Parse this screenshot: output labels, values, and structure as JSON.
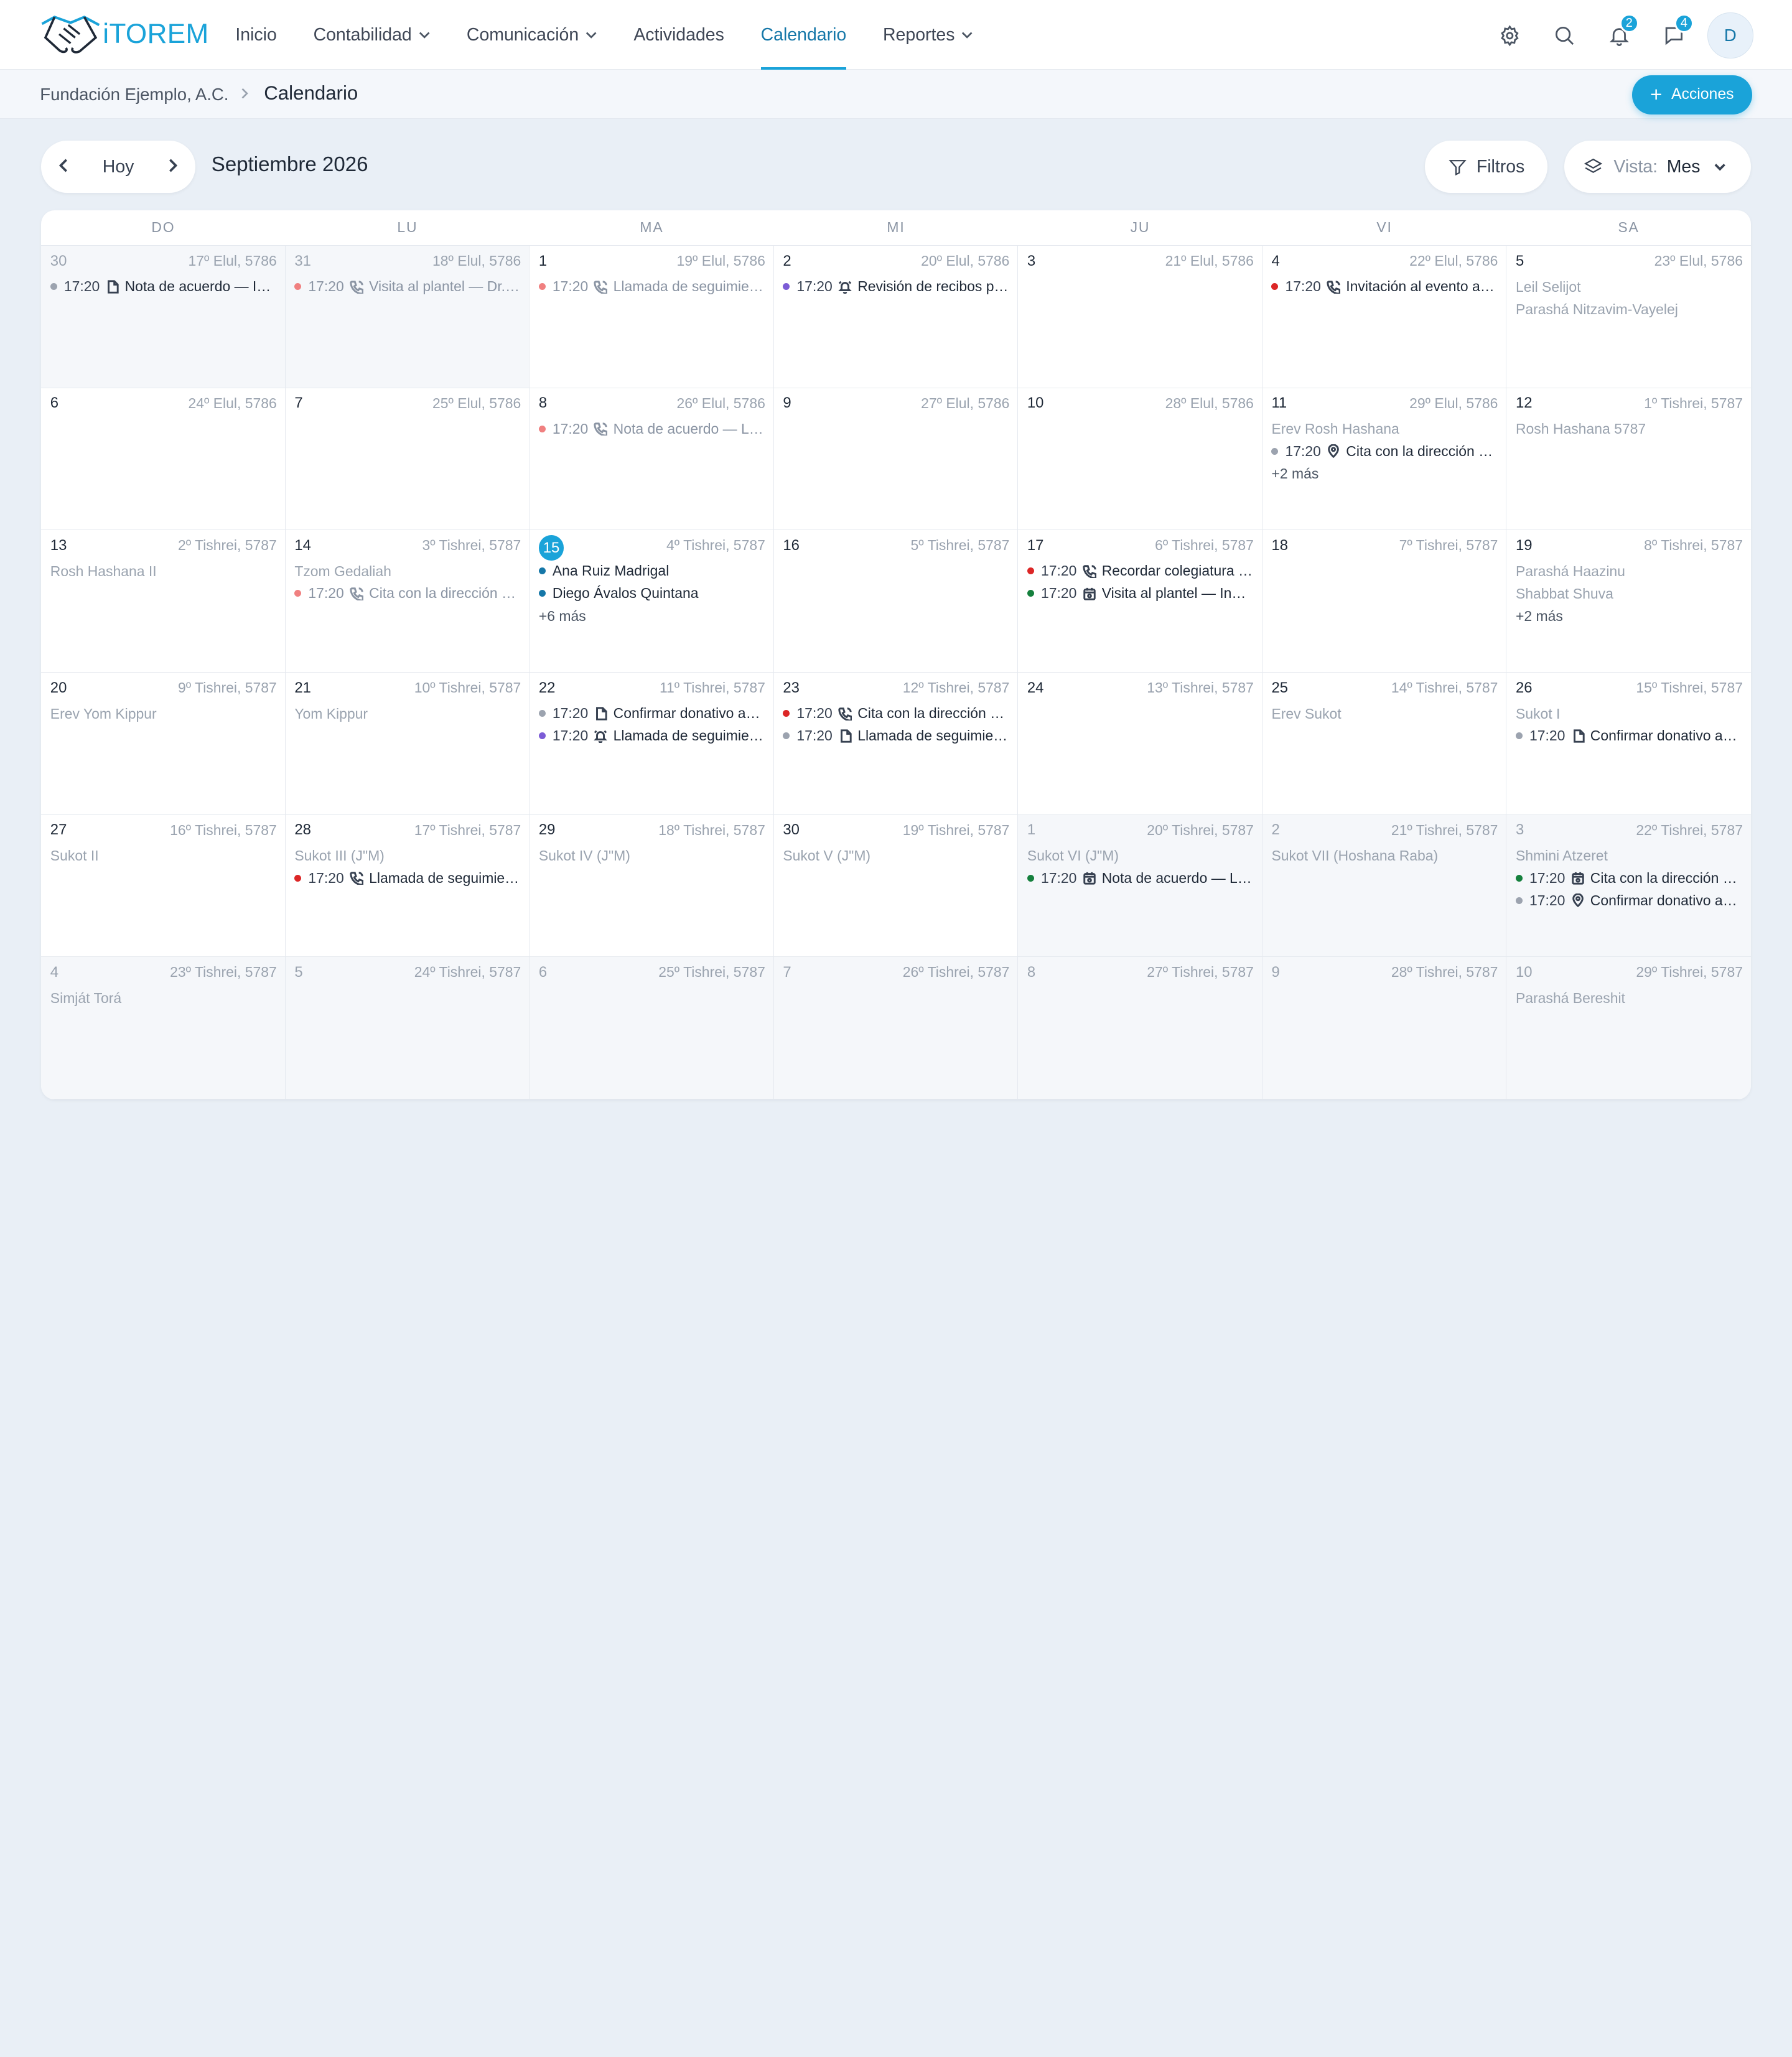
{
  "app": {
    "logo_text": "iTOREM"
  },
  "nav": {
    "items": [
      {
        "label": "Inicio",
        "dropdown": false,
        "active": false
      },
      {
        "label": "Contabilidad",
        "dropdown": true,
        "active": false
      },
      {
        "label": "Comunicación",
        "dropdown": true,
        "active": false
      },
      {
        "label": "Actividades",
        "dropdown": false,
        "active": false
      },
      {
        "label": "Calendario",
        "dropdown": false,
        "active": true
      },
      {
        "label": "Reportes",
        "dropdown": true,
        "active": false
      }
    ],
    "notifications_count": "2",
    "messages_count": "4",
    "avatar_initial": "D"
  },
  "breadcrumb": {
    "parent": "Fundación Ejemplo, A.C.",
    "current": "Calendario"
  },
  "actions_label": "Acciones",
  "toolbar": {
    "today_label": "Hoy",
    "month_title": "Septiembre 2026",
    "filters_label": "Filtros",
    "view_label": "Vista:",
    "view_value": "Mes"
  },
  "colors": {
    "accent": "#1aa3d9",
    "red": "#dc2626",
    "pink": "#f08080",
    "purple": "#7c5cd6",
    "green": "#15803d",
    "gray": "#9ca3af",
    "blue": "#1577a8"
  },
  "calendar": {
    "weekdays": [
      "DO",
      "LU",
      "MA",
      "MI",
      "JU",
      "VI",
      "SA"
    ],
    "days": [
      {
        "day": "30",
        "heb": "17º Elul, 5786",
        "out": true,
        "events": [
          {
            "color": "#9ca3af",
            "time": "17:20",
            "icon": "document",
            "title": "Nota de acuerdo — Ing. Pablo Ríos",
            "muted": false
          }
        ]
      },
      {
        "day": "31",
        "heb": "18º Elul, 5786",
        "out": true,
        "events": [
          {
            "color": "#f08080",
            "time": "17:20",
            "icon": "phone",
            "title": "Visita al plantel — Dr. Samuel Levi",
            "muted": true
          }
        ]
      },
      {
        "day": "1",
        "heb": "19º Elul, 5786",
        "events": [
          {
            "color": "#f08080",
            "time": "17:20",
            "icon": "phone",
            "title": "Llamada de seguimiento",
            "muted": true
          }
        ]
      },
      {
        "day": "2",
        "heb": "20º Elul, 5786",
        "events": [
          {
            "color": "#7c5cd6",
            "time": "17:20",
            "icon": "bell",
            "title": "Revisión de recibos pendientes",
            "muted": false
          }
        ]
      },
      {
        "day": "3",
        "heb": "21º Elul, 5786"
      },
      {
        "day": "4",
        "heb": "22º Elul, 5786",
        "events": [
          {
            "color": "#dc2626",
            "time": "17:20",
            "icon": "phone",
            "title": "Invitación al evento anual",
            "muted": false
          }
        ]
      },
      {
        "day": "5",
        "heb": "23º Elul, 5786",
        "holidays": [
          "Leil Selijot",
          "Parashá Nitzavim-Vayelej"
        ]
      },
      {
        "day": "6",
        "heb": "24º Elul, 5786"
      },
      {
        "day": "7",
        "heb": "25º Elul, 5786"
      },
      {
        "day": "8",
        "heb": "26º Elul, 5786",
        "events": [
          {
            "color": "#f08080",
            "time": "17:20",
            "icon": "phone",
            "title": "Nota de acuerdo — Lic. Sara Cohen",
            "muted": true
          }
        ]
      },
      {
        "day": "9",
        "heb": "27º Elul, 5786"
      },
      {
        "day": "10",
        "heb": "28º Elul, 5786"
      },
      {
        "day": "11",
        "heb": "29º Elul, 5786",
        "holidays": [
          "Erev Rosh Hashana"
        ],
        "events": [
          {
            "color": "#9ca3af",
            "time": "17:20",
            "icon": "pin",
            "title": "Cita con la dirección general",
            "muted": false
          }
        ],
        "more": "+2 más"
      },
      {
        "day": "12",
        "heb": "1º Tishrei, 5787",
        "holidays": [
          "Rosh Hashana 5787"
        ]
      },
      {
        "day": "13",
        "heb": "2º Tishrei, 5787",
        "holidays": [
          "Rosh Hashana II"
        ]
      },
      {
        "day": "14",
        "heb": "3º Tishrei, 5787",
        "holidays": [
          "Tzom Gedaliah"
        ],
        "events": [
          {
            "color": "#f08080",
            "time": "17:20",
            "icon": "phone",
            "title": "Cita con la dirección general",
            "muted": true
          }
        ]
      },
      {
        "day": "15",
        "heb": "4º Tishrei, 5787",
        "today": true,
        "people": [
          "Ana Ruiz Madrigal",
          "Diego Ávalos Quintana"
        ],
        "more": "+6 más"
      },
      {
        "day": "16",
        "heb": "5º Tishrei, 5787"
      },
      {
        "day": "17",
        "heb": "6º Tishrei, 5787",
        "events": [
          {
            "color": "#dc2626",
            "time": "17:20",
            "icon": "phone",
            "title": "Recordar colegiatura de octubre",
            "muted": false
          },
          {
            "color": "#15803d",
            "time": "17:20",
            "icon": "calendar",
            "title": "Visita al plantel — Ing. Marcos Díaz",
            "muted": false
          }
        ]
      },
      {
        "day": "18",
        "heb": "7º Tishrei, 5787"
      },
      {
        "day": "19",
        "heb": "8º Tishrei, 5787",
        "holidays": [
          "Parashá Haazinu",
          "Shabbat Shuva"
        ],
        "more": "+2 más"
      },
      {
        "day": "20",
        "heb": "9º Tishrei, 5787",
        "holidays": [
          "Erev Yom Kippur"
        ]
      },
      {
        "day": "21",
        "heb": "10º Tishrei, 5787",
        "holidays": [
          "Yom Kippur"
        ]
      },
      {
        "day": "22",
        "heb": "11º Tishrei, 5787",
        "events": [
          {
            "color": "#9ca3af",
            "time": "17:20",
            "icon": "document",
            "title": "Confirmar donativo anual",
            "muted": false
          },
          {
            "color": "#7c5cd6",
            "time": "17:20",
            "icon": "bell",
            "title": "Llamada de seguimiento",
            "muted": false
          }
        ]
      },
      {
        "day": "23",
        "heb": "12º Tishrei, 5787",
        "events": [
          {
            "color": "#dc2626",
            "time": "17:20",
            "icon": "phone",
            "title": "Cita con la dirección general",
            "muted": false
          },
          {
            "color": "#9ca3af",
            "time": "17:20",
            "icon": "document",
            "title": "Llamada de seguimiento",
            "muted": false
          }
        ]
      },
      {
        "day": "24",
        "heb": "13º Tishrei, 5787"
      },
      {
        "day": "25",
        "heb": "14º Tishrei, 5787",
        "holidays": [
          "Erev Sukot"
        ]
      },
      {
        "day": "26",
        "heb": "15º Tishrei, 5787",
        "holidays": [
          "Sukot I"
        ],
        "events": [
          {
            "color": "#9ca3af",
            "time": "17:20",
            "icon": "document",
            "title": "Confirmar donativo anual",
            "muted": false
          }
        ]
      },
      {
        "day": "27",
        "heb": "16º Tishrei, 5787",
        "holidays": [
          "Sukot II"
        ]
      },
      {
        "day": "28",
        "heb": "17º Tishrei, 5787",
        "holidays": [
          "Sukot III (J\"M)"
        ],
        "events": [
          {
            "color": "#dc2626",
            "time": "17:20",
            "icon": "phone",
            "title": "Llamada de seguimiento",
            "muted": false
          }
        ]
      },
      {
        "day": "29",
        "heb": "18º Tishrei, 5787",
        "holidays": [
          "Sukot IV (J\"M)"
        ]
      },
      {
        "day": "30",
        "heb": "19º Tishrei, 5787",
        "holidays": [
          "Sukot V (J\"M)"
        ]
      },
      {
        "day": "1",
        "heb": "20º Tishrei, 5787",
        "out": true,
        "holidays": [
          "Sukot VI (J\"M)"
        ],
        "events": [
          {
            "color": "#15803d",
            "time": "17:20",
            "icon": "calendar",
            "title": "Nota de acuerdo — Lic. Ruth Mizrahi",
            "muted": false
          }
        ]
      },
      {
        "day": "2",
        "heb": "21º Tishrei, 5787",
        "out": true,
        "holidays": [
          "Sukot VII (Hoshana Raba)"
        ]
      },
      {
        "day": "3",
        "heb": "22º Tishrei, 5787",
        "out": true,
        "holidays": [
          "Shmini Atzeret"
        ],
        "events": [
          {
            "color": "#15803d",
            "time": "17:20",
            "icon": "calendar",
            "title": "Cita con la dirección general",
            "muted": false
          },
          {
            "color": "#9ca3af",
            "time": "17:20",
            "icon": "pin",
            "title": "Confirmar donativo anual",
            "muted": false
          }
        ]
      },
      {
        "day": "4",
        "heb": "23º Tishrei, 5787",
        "out": true,
        "holidays": [
          "Simját Torá"
        ]
      },
      {
        "day": "5",
        "heb": "24º Tishrei, 5787",
        "out": true
      },
      {
        "day": "6",
        "heb": "25º Tishrei, 5787",
        "out": true
      },
      {
        "day": "7",
        "heb": "26º Tishrei, 5787",
        "out": true
      },
      {
        "day": "8",
        "heb": "27º Tishrei, 5787",
        "out": true
      },
      {
        "day": "9",
        "heb": "28º Tishrei, 5787",
        "out": true
      },
      {
        "day": "10",
        "heb": "29º Tishrei, 5787",
        "out": true,
        "holidays": [
          "Parashá Bereshit"
        ]
      }
    ]
  }
}
